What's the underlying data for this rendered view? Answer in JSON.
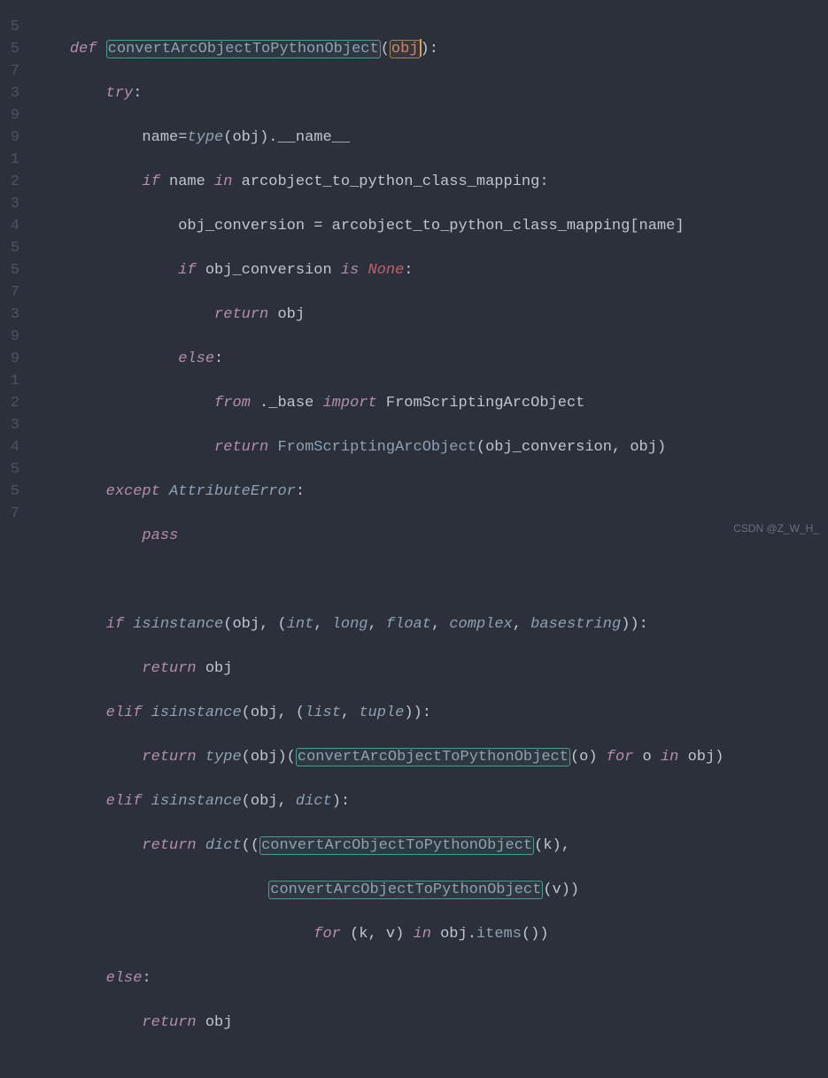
{
  "editor": {
    "theme": "dark",
    "language": "python",
    "gutter": [
      "5",
      "5",
      "7",
      "3",
      "9",
      "9",
      "1",
      "2",
      "3",
      "4",
      "5",
      "5",
      "7",
      "3",
      "9",
      "9",
      "1",
      "2",
      "3",
      "4",
      "5",
      "5",
      "7"
    ],
    "cursor": {
      "line": 0,
      "after_token": "obj"
    },
    "highlighted_symbol": "convertArcObjectToPythonObject",
    "tokens": {
      "l0": {
        "def": "def",
        "fname": "convertArcObjectToPythonObject",
        "lp": "(",
        "param": "obj",
        "rp": ")",
        "colon": ":"
      },
      "l1": {
        "try": "try",
        "colon": ":"
      },
      "l2": {
        "name": "name",
        "eq": "=",
        "type": "type",
        "lp": "(",
        "obj": "obj",
        "rp": ")",
        "dot": ".__name__"
      },
      "l3": {
        "if": "if",
        "name": " name ",
        "in": "in",
        "map": " arcobject_to_python_class_mapping",
        "colon": ":"
      },
      "l4": {
        "lhs": "obj_conversion ",
        "eq": "=",
        "rhs": " arcobject_to_python_class_mapping[name]"
      },
      "l5": {
        "if": "if",
        "cond": " obj_conversion ",
        "is": "is",
        "sp": " ",
        "none": "None",
        "colon": ":"
      },
      "l6": {
        "return": "return",
        "obj": " obj"
      },
      "l7": {
        "else": "else",
        "colon": ":"
      },
      "l8": {
        "from": "from",
        "mod": " ._base ",
        "import": "import",
        "name": " FromScriptingArcObject"
      },
      "l9": {
        "return": "return",
        "sp": " ",
        "call": "FromScriptingArcObject",
        "args": "(obj_conversion, obj)"
      },
      "l10": {
        "except": "except",
        "sp": " ",
        "err": "AttributeError",
        "colon": ":"
      },
      "l11": {
        "pass": "pass"
      },
      "l12": {
        "blank": ""
      },
      "l13": {
        "if": "if",
        "sp": " ",
        "isi": "isinstance",
        "lp": "(obj, (",
        "t1": "int",
        "c1": ", ",
        "t2": "long",
        "c2": ", ",
        "t3": "float",
        "c3": ", ",
        "t4": "complex",
        "c4": ", ",
        "t5": "basestring",
        "rp": "))",
        "colon": ":"
      },
      "l14": {
        "return": "return",
        "obj": " obj"
      },
      "l15": {
        "elif": "elif",
        "sp": " ",
        "isi": "isinstance",
        "lp": "(obj, (",
        "t1": "list",
        "c1": ", ",
        "t2": "tuple",
        "rp": "))",
        "colon": ":"
      },
      "l16": {
        "return": "return",
        "sp": " ",
        "type": "type",
        "a1": "(obj)(",
        "fn": "convertArcObjectToPythonObject",
        "a2": "(o) ",
        "for": "for",
        "mid": " o ",
        "in": "in",
        "tail": " obj)"
      },
      "l17": {
        "elif": "elif",
        "sp": " ",
        "isi": "isinstance",
        "lp": "(obj, ",
        "t1": "dict",
        "rp": ")",
        "colon": ":"
      },
      "l18": {
        "return": "return",
        "sp": " ",
        "dict": "dict",
        "lp": "((",
        "fn": "convertArcObjectToPythonObject",
        "args": "(k),"
      },
      "l19": {
        "fn": "convertArcObjectToPythonObject",
        "args": "(v))"
      },
      "l20": {
        "for": "for",
        "mid": " (k, v) ",
        "in": "in",
        "obj": " obj",
        "dot": ".",
        "items": "items",
        "tail": "())"
      },
      "l21": {
        "else": "else",
        "colon": ":"
      },
      "l22": {
        "return": "return",
        "obj": " obj"
      }
    }
  },
  "watermark": "CSDN @Z_W_H_"
}
